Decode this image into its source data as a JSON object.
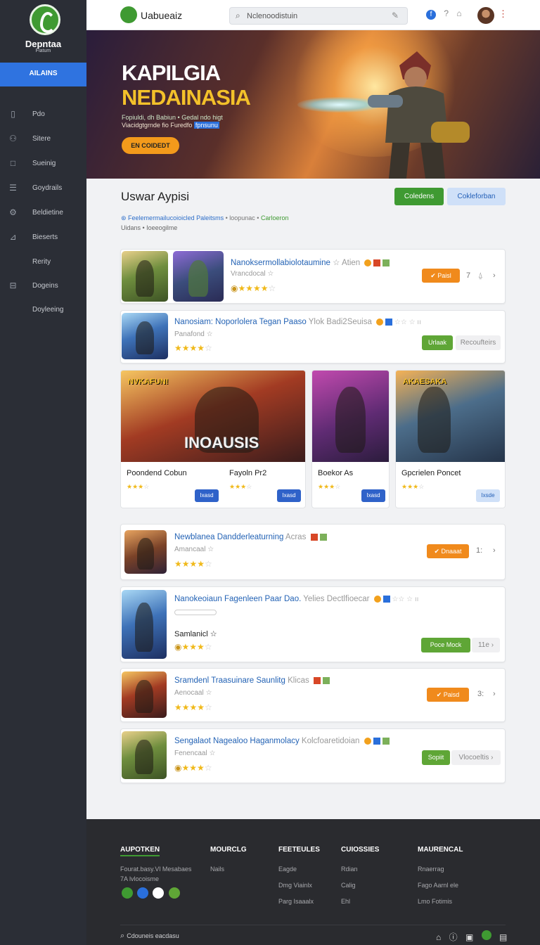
{
  "sidebar": {
    "brand": "Depntaa",
    "brand_sub": "Fiatum",
    "active_label": "AILAINS",
    "items": [
      {
        "label": "Pdo",
        "icon": "grid-icon"
      },
      {
        "label": "Sitere",
        "icon": "user-icon"
      },
      {
        "label": "Sueinig",
        "icon": "square-icon"
      },
      {
        "label": "Goydrails",
        "icon": "list-icon"
      },
      {
        "label": "Beldietine",
        "icon": "gear-icon"
      },
      {
        "label": "Bieserts",
        "icon": "chart-icon"
      },
      {
        "label": "Rerity",
        "icon": ""
      },
      {
        "label": "Dogeins",
        "icon": "lock-icon"
      },
      {
        "label": "Doyleeing",
        "icon": ""
      }
    ]
  },
  "topbar": {
    "title": "Uabueaiz",
    "search_value": "Nclenoodistuin"
  },
  "hero": {
    "title1": "KAPILGIA",
    "title2": "NEDAINASIA",
    "desc1": "Fopiuldi, dh Babiun • Gedal ndo higt",
    "desc2": "Viacidgtgrnde fio Furedfo ",
    "desc2_link": "fpnsunu",
    "cta": "EN COIDEDT"
  },
  "section": {
    "title": "Uswar Aypisi",
    "btn_green": "Coledens",
    "btn_blue": "Cokleforban",
    "meta_blue": "Feelemermailucoioicled Paleitsms",
    "meta_gray": " • loopunac • ",
    "meta_green": "Carloeron",
    "meta2": "Uidans • Ioeeogilme"
  },
  "list1": [
    {
      "title": "Nanoksermollabiolotaumine",
      "extra": " ☆ Atien",
      "sub": "Vrancdocal  ☆",
      "action": "Paisl",
      "count": "7"
    },
    {
      "title": "Nanosiam: Noporlolera Tegan Paaso",
      "extra": " Ylok Badi2Seuisa",
      "sub": "Panafond  ☆",
      "action": "Urlaak",
      "secondary": "Recoufteirs"
    }
  ],
  "grid": [
    {
      "name": "Poondend Cobun",
      "btn": "Ixasd",
      "banner": "NVKAFUN!"
    },
    {
      "name": "Fayoln Pr2",
      "btn": "Ixasd",
      "label": "INOAUSIS"
    },
    {
      "name": "Boekor As",
      "btn": "Ixasd"
    },
    {
      "name": "Gpcrielen Poncet",
      "btn": "Ixsde",
      "banner": "AKAESAKA"
    }
  ],
  "list2": [
    {
      "title": "Newblanea Dandderleaturning",
      "extra": " Acras",
      "sub": "Amancaal  ☆",
      "action": "Dnaaat",
      "count": "1:"
    },
    {
      "title": "Nanokeoiaun Fagenleen Paar Dao.",
      "extra": " Yelies Dectlfioecar",
      "sub2": "Samlanicl  ☆",
      "action": "Poce Mock",
      "count": "11e"
    },
    {
      "title": "Sramdenl Traasuinare Saunlitg",
      "extra": " Klicas",
      "sub": "Aenocaal  ☆",
      "action": "Paisd",
      "count": "3:"
    },
    {
      "title": "Sengalaot Nagealoo Haganmolacy",
      "extra": " Kolcfoaretidoian",
      "sub": "Fenencaal  ☆",
      "action": "Sopiit",
      "secondary": "Vlocoeltis"
    }
  ],
  "footer": {
    "brand": "AUPOTKEN",
    "desc1": "Fourat.basy.Vl Mesabaes",
    "desc2": "7A lvlocoisme",
    "cols": [
      {
        "head": "MOURCLG",
        "items": [
          "Nails"
        ]
      },
      {
        "head": "FEETEULES",
        "items": [
          "Eagde",
          "Dmg Viainlx",
          "Parg Isaaalx"
        ]
      },
      {
        "head": "CUIOSSIES",
        "items": [
          "Rdian",
          "Calig",
          "Ehl"
        ]
      },
      {
        "head": "MAURENCAL",
        "items": [
          "Rnaerrag",
          "Fago Aarnl ele",
          "Lmo Fotimis"
        ]
      }
    ],
    "search_label": "Cdouneis eacdasu"
  },
  "colors": {
    "accent": "#2f73e0",
    "green": "#3f9a32",
    "orange": "#f08a1c",
    "sidebar": "#2b2e36"
  }
}
